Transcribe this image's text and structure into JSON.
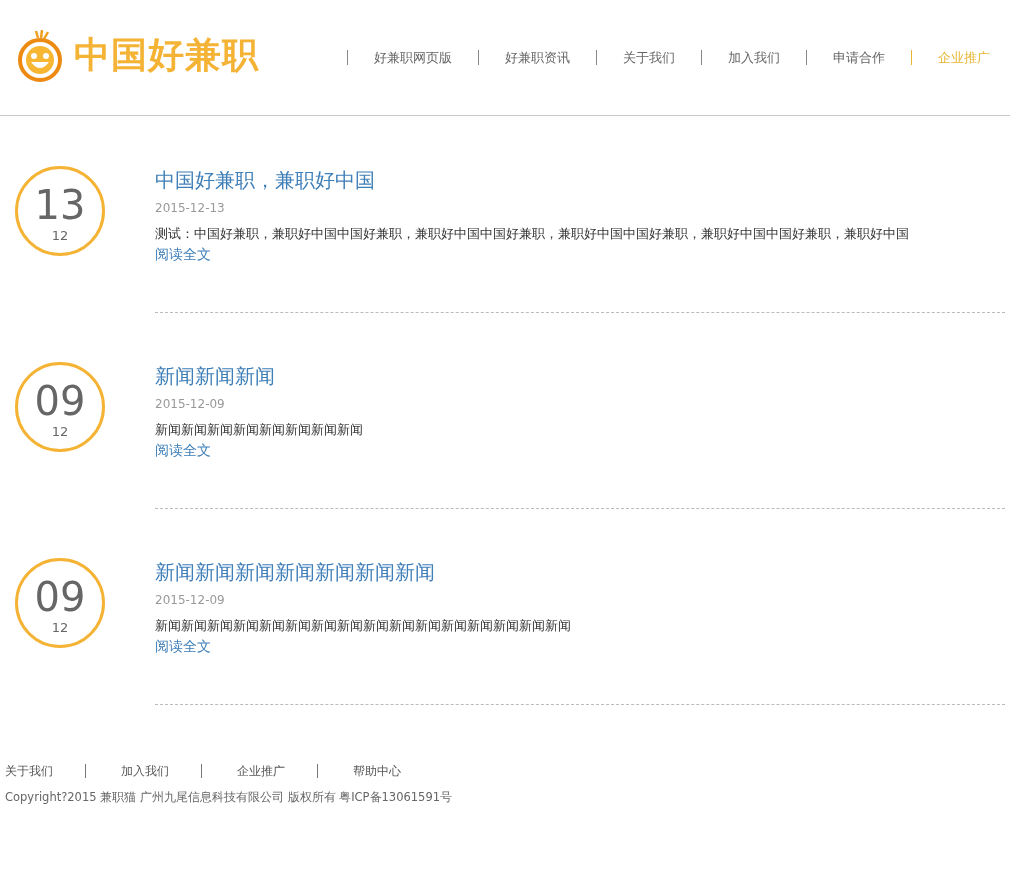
{
  "header": {
    "logo_text": "中国好兼职",
    "nav": [
      {
        "label": "好兼职网页版",
        "selected": false
      },
      {
        "label": "好兼职资讯",
        "selected": false
      },
      {
        "label": "关于我们",
        "selected": false
      },
      {
        "label": "加入我们",
        "selected": false
      },
      {
        "label": "申请合作",
        "selected": false
      },
      {
        "label": "企业推广",
        "selected": true
      }
    ]
  },
  "articles": [
    {
      "day": "13",
      "month": "12",
      "title": "中国好兼职，兼职好中国",
      "date": "2015-12-13",
      "summary": "测试：中国好兼职，兼职好中国中国好兼职，兼职好中国中国好兼职，兼职好中国中国好兼职，兼职好中国中国好兼职，兼职好中国",
      "link": "阅读全文"
    },
    {
      "day": "09",
      "month": "12",
      "title": "新闻新闻新闻",
      "date": "2015-12-09",
      "summary": "新闻新闻新闻新闻新闻新闻新闻新闻",
      "link": "阅读全文"
    },
    {
      "day": "09",
      "month": "12",
      "title": "新闻新闻新闻新闻新闻新闻新闻",
      "date": "2015-12-09",
      "summary": "新闻新闻新闻新闻新闻新闻新闻新闻新闻新闻新闻新闻新闻新闻新闻新闻",
      "link": "阅读全文"
    }
  ],
  "footer": {
    "links": [
      "关于我们",
      "加入我们",
      "企业推广",
      "帮助中心"
    ],
    "copyright": "Copyright?2015 兼职猫 广州九尾信息科技有限公司 版权所有 粤ICP备13061591号"
  }
}
